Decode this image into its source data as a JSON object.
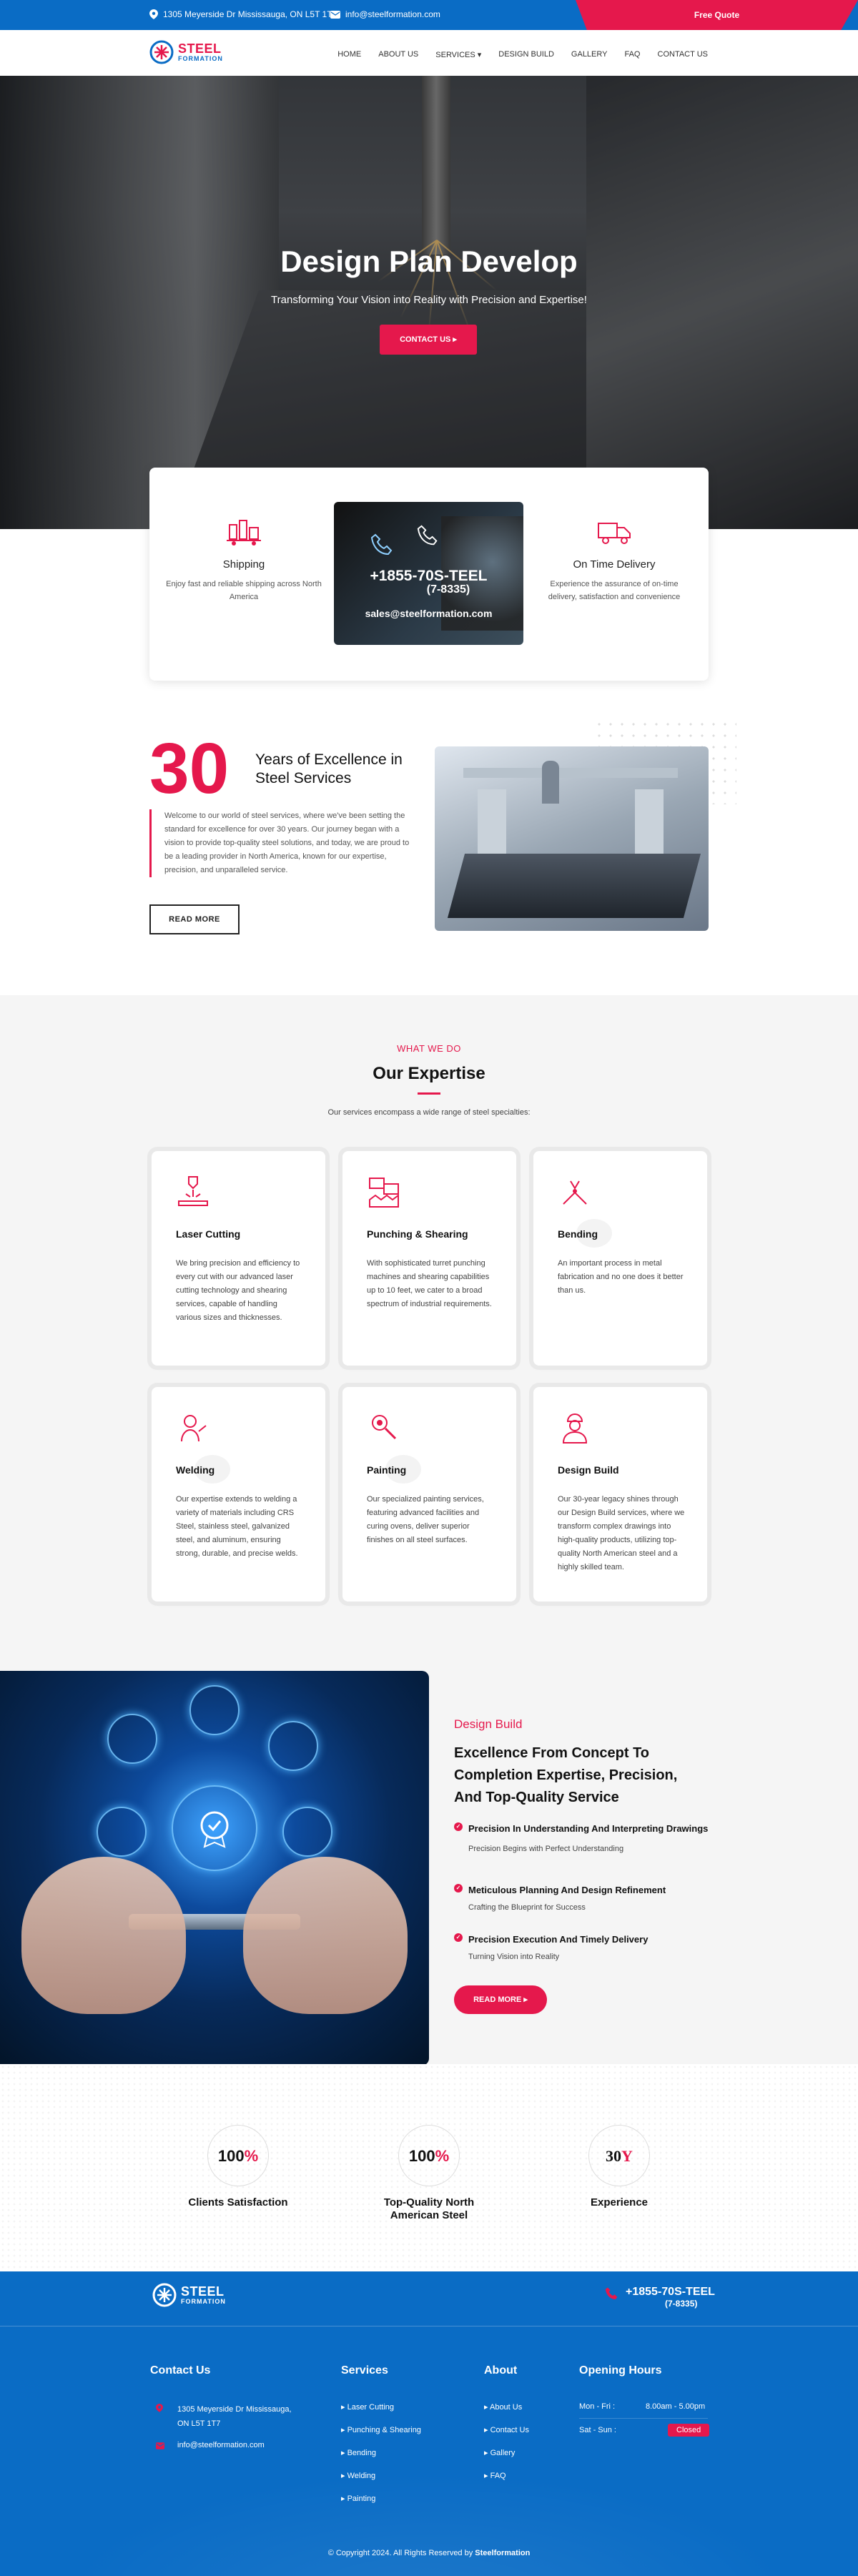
{
  "topbar": {
    "address": "1305 Meyerside Dr Mississauga, ON L5T 1T7",
    "email": "info@steelformation.com",
    "quote_label": "Free Quote"
  },
  "brand": {
    "name_top": "STEEL",
    "name_bottom": "FORMATION"
  },
  "nav": {
    "items": [
      "HOME",
      "ABOUT US",
      "SERVICES ▾",
      "DESIGN BUILD",
      "GALLERY",
      "FAQ",
      "CONTACT US"
    ]
  },
  "hero": {
    "title": "Design Plan Develop",
    "subtitle": "Transforming Your Vision into Reality with Precision and Expertise!",
    "cta": "CONTACT US ▸"
  },
  "features": {
    "shipping": {
      "title": "Shipping",
      "text": "Enjoy fast and reliable shipping across North America"
    },
    "call": {
      "phone_line1": "+1855-70S-TEEL",
      "phone_line2": "(7-8335)",
      "email": "sales@steelformation.com"
    },
    "delivery": {
      "title": "On Time Delivery",
      "text": "Experience the assurance of on-time delivery, satisfaction and convenience"
    }
  },
  "about": {
    "number": "30",
    "title_line1": "Years of Excellence in",
    "title_line2": "Steel Services",
    "text": "Welcome to our world of steel services, where we've been setting the standard for excellence for over 30 years. Our journey began with a vision to provide top-quality steel solutions, and today, we are proud to be a leading provider in North America, known for our expertise, precision, and unparalleled service.",
    "button": "READ MORE"
  },
  "expertise": {
    "tag": "WHAT WE DO",
    "title": "Our Expertise",
    "subtitle": "Our services encompass a wide range of steel specialties:",
    "cards": [
      {
        "title": "Laser Cutting",
        "text": "We bring precision and efficiency to every cut with our advanced laser cutting technology and shearing services, capable of handling various sizes and thicknesses."
      },
      {
        "title": "Punching & Shearing",
        "text": "With sophisticated turret punching machines and shearing capabilities up to 10 feet, we cater to a broad spectrum of industrial requirements."
      },
      {
        "title": "Bending",
        "text": "An important process in metal fabrication and no one does it better than us."
      },
      {
        "title": "Welding",
        "text": "Our expertise extends to welding a variety of materials including CRS Steel, stainless steel, galvanized steel, and aluminum, ensuring strong, durable, and precise welds."
      },
      {
        "title": "Painting",
        "text": "Our specialized painting services, featuring advanced facilities and curing ovens, deliver superior finishes on all steel surfaces."
      },
      {
        "title": "Design Build",
        "text": "Our 30-year legacy shines through our Design Build services, where we transform complex drawings into high-quality products, utilizing top-quality North American steel and a highly skilled team."
      }
    ]
  },
  "design_build": {
    "tag": "Design Build",
    "title": "Excellence From Concept To Completion Expertise, Precision, And Top-Quality Service",
    "points": [
      {
        "title": "Precision In Understanding And Interpreting Drawings",
        "sub": "Precision Begins with Perfect Understanding"
      },
      {
        "title": "Meticulous Planning And Design Refinement",
        "sub": "Crafting the Blueprint for Success"
      },
      {
        "title": "Precision Execution And Timely Delivery",
        "sub": "Turning Vision into Reality"
      }
    ],
    "button": "READ MORE ▸"
  },
  "stats": [
    {
      "value": "100",
      "suffix": "%",
      "label": "Clients Satisfaction"
    },
    {
      "value": "100",
      "suffix": "%",
      "label": "Top-Quality North American Steel"
    },
    {
      "value": "30",
      "suffix": "Y",
      "label": "Experience"
    }
  ],
  "footer": {
    "phone_line1": "+1855-70S-TEEL",
    "phone_line2": "(7-8335)",
    "contact_title": "Contact Us",
    "address": "1305 Meyerside Dr Mississauga, ON L5T 1T7",
    "email": "info@steelformation.com",
    "services_title": "Services",
    "services": [
      "Laser Cutting",
      "Punching & Shearing",
      "Bending",
      "Welding",
      "Painting"
    ],
    "about_title": "About",
    "about_links": [
      "About Us",
      "Contact Us",
      "Gallery",
      "FAQ"
    ],
    "hours_title": "Opening Hours",
    "weekday_label": "Mon - Fri :",
    "weekday_hours": "8.00am - 5.00pm",
    "weekend_label": "Sat - Sun :",
    "weekend_hours": "Closed",
    "copyright_prefix": "© Copyright 2024. All Rights Reserved by ",
    "copyright_brand": "Steelformation"
  },
  "colors": {
    "primary_blue": "#0a6cc5",
    "accent_red": "#e5184c"
  }
}
